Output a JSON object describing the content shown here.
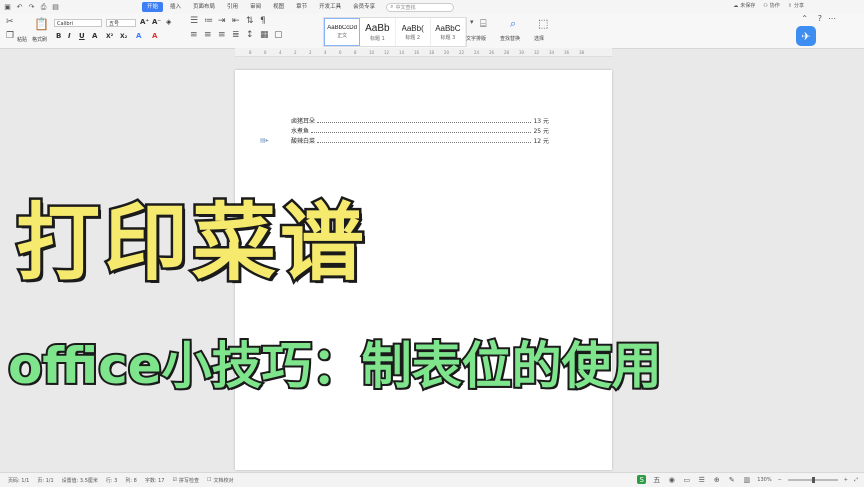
{
  "menubar": {
    "quick_icons": [
      "save-icon",
      "undo-icon",
      "redo-icon",
      "print-icon",
      "preview-icon"
    ],
    "tabs": [
      {
        "label": "开始",
        "active": true
      },
      {
        "label": "插入",
        "active": false
      },
      {
        "label": "页面布局",
        "active": false
      },
      {
        "label": "引用",
        "active": false
      },
      {
        "label": "审阅",
        "active": false
      },
      {
        "label": "视图",
        "active": false
      },
      {
        "label": "章节",
        "active": false
      },
      {
        "label": "开发工具",
        "active": false
      },
      {
        "label": "会员专享",
        "active": false
      }
    ],
    "search_placeholder": "中文查找",
    "unsync_label": "未保存",
    "collab_label": "协作",
    "share_label": "分享"
  },
  "ribbon": {
    "paste_label": "粘贴",
    "format_painter_label": "格式刷",
    "font_name": "Calibri",
    "font_size": "五号",
    "styles": [
      {
        "sample": "AaBbCcDd",
        "name": "正文",
        "selected": true
      },
      {
        "sample": "AaBb",
        "name": "标题 1",
        "selected": false
      },
      {
        "sample": "AaBb(",
        "name": "标题 2",
        "selected": false
      },
      {
        "sample": "AaBbC",
        "name": "标题 3",
        "selected": false
      }
    ],
    "text_tools_label": "文字排版",
    "find_replace_label": "查找替换",
    "select_label": "选择"
  },
  "document": {
    "rows": [
      {
        "dish": "卤猪耳朵",
        "price": "13 元"
      },
      {
        "dish": "水煮鱼",
        "price": "25 元"
      },
      {
        "dish": "酸辣白菜",
        "price": "12 元"
      }
    ]
  },
  "overlay": {
    "title_main": "打印菜谱",
    "title_sub": "office小技巧：制表位的使用"
  },
  "statusbar": {
    "page": "页码: 1/1",
    "pages": "页: 1/1",
    "position": "设置值: 3.5厘米",
    "line": "行: 3",
    "column": "列: 8",
    "word_count": "字数: 17",
    "spell_check": "拼写检查",
    "doc_check": "文档校对",
    "zoom": "130%"
  },
  "colors": {
    "accent": "#3c7ef4",
    "title_main": "#f6ea6e",
    "title_sub": "#7fe58d",
    "outline": "#1b1b1b"
  }
}
